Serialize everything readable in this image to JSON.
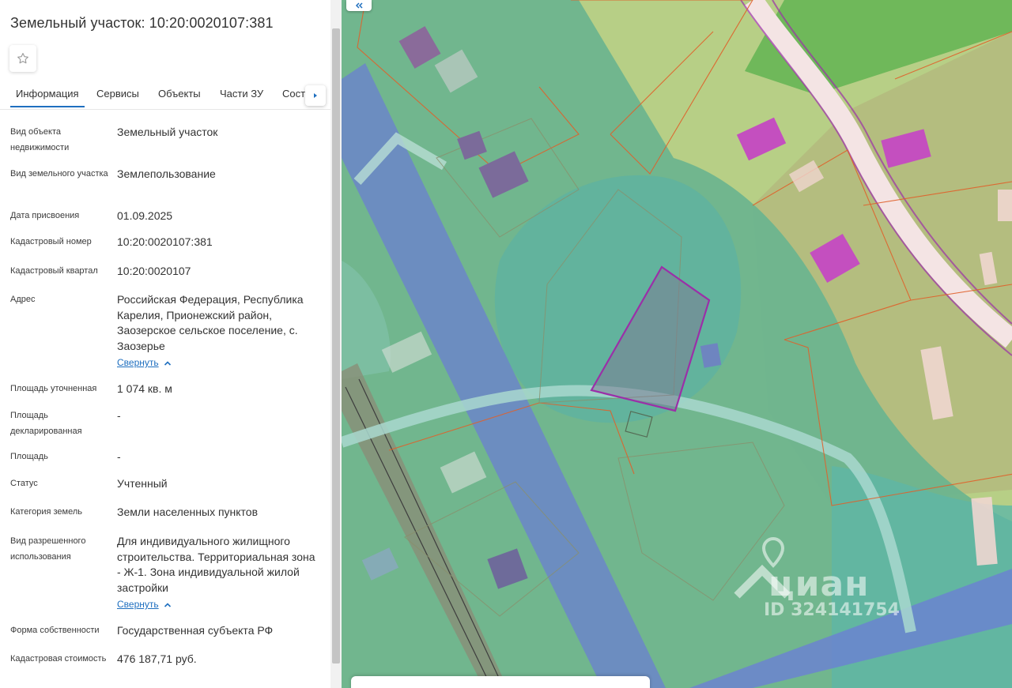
{
  "panel": {
    "title": "Земельный участок: 10:20:0020107:381",
    "tabs": [
      "Информация",
      "Сервисы",
      "Объекты",
      "Части ЗУ",
      "Состав"
    ],
    "rows": [
      {
        "label": "Вид объекта недвижимости",
        "value": "Земельный участок"
      },
      {
        "label": "Вид земельного участка",
        "value": "Землепользование"
      },
      {
        "label": "Дата присвоения",
        "value": "01.09.2025"
      },
      {
        "label": "Кадастровый номер",
        "value": "10:20:0020107:381"
      },
      {
        "label": "Кадастровый квартал",
        "value": "10:20:0020107"
      },
      {
        "label": "Адрес",
        "value": "Российская Федерация, Республика Карелия, Прионежский район, Заозерское сельское поселение, с. Заозерье",
        "link": "Свернуть"
      },
      {
        "label": "Площадь уточненная",
        "value": "1 074 кв. м"
      },
      {
        "label": "Площадь декларированная",
        "value": "-"
      },
      {
        "label": "Площадь",
        "value": "-"
      },
      {
        "label": "Статус",
        "value": "Учтенный"
      },
      {
        "label": "Категория земель",
        "value": "Земли населенных пунктов"
      },
      {
        "label": "Вид разрешенного использования",
        "value": "Для индивидуального жилищного строительства. Территориальная зона - Ж-1. Зона индивидуальной жилой застройки",
        "link": "Свернуть"
      },
      {
        "label": "Форма собственности",
        "value": "Государственная субъекта РФ"
      },
      {
        "label": "Кадастровая стоимость",
        "value": "476 187,71 руб."
      }
    ]
  },
  "map": {
    "watermark_brand": "циан",
    "watermark_id": "ID 324141754"
  },
  "icons": {
    "star": "star-icon",
    "tab_next": "chevron-right-icon",
    "collapse": "chevron-up-icon",
    "map_collapse": "double-chevron-left-icon",
    "watermark_pin": "map-pin-icon"
  },
  "colors": {
    "accent": "#1f6fbf",
    "parcel_outline": "#9b2fa8",
    "boundary_red": "#e0602a"
  }
}
